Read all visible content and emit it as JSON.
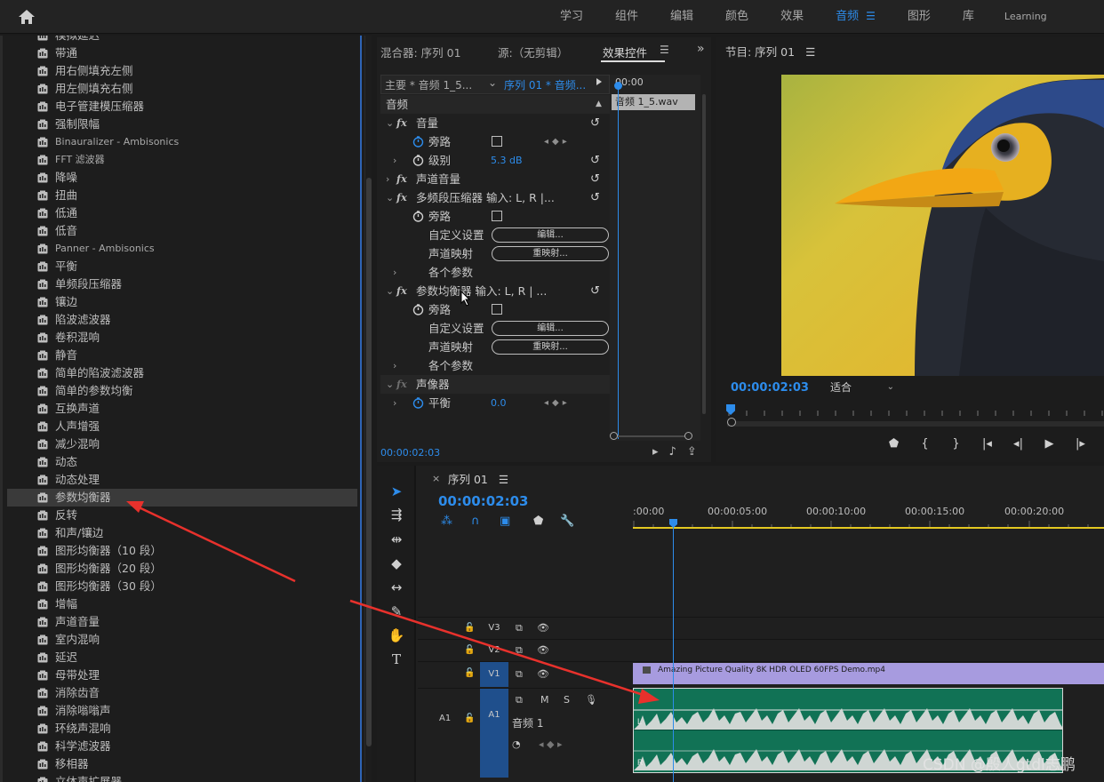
{
  "topbar": {
    "tabs": [
      {
        "label": "学习"
      },
      {
        "label": "组件"
      },
      {
        "label": "编辑"
      },
      {
        "label": "颜色"
      },
      {
        "label": "效果"
      },
      {
        "label": "音频"
      },
      {
        "label": "图形"
      },
      {
        "label": "库"
      },
      {
        "label": "Learning"
      }
    ],
    "active_color": "#2d8ceb"
  },
  "effects_list": {
    "items": [
      "模拟延迟",
      "带通",
      "用右侧填充左侧",
      "用左侧填充右侧",
      "电子管建模压缩器",
      "强制限幅",
      "Binauralizer - Ambisonics",
      "FFT 滤波器",
      "降噪",
      "扭曲",
      "低通",
      "低音",
      "Panner - Ambisonics",
      "平衡",
      "单频段压缩器",
      "镶边",
      "陷波滤波器",
      "卷积混响",
      "静音",
      "简单的陷波滤波器",
      "简单的参数均衡",
      "互换声道",
      "人声增强",
      "减少混响",
      "动态",
      "动态处理",
      "参数均衡器",
      "反转",
      "和声/镶边",
      "图形均衡器（10 段）",
      "图形均衡器（20 段）",
      "图形均衡器（30 段）",
      "增幅",
      "声道音量",
      "室内混响",
      "延迟",
      "母带处理",
      "消除齿音",
      "消除嗡嗡声",
      "环绕声混响",
      "科学滤波器",
      "移相器",
      "立体声扩展器"
    ],
    "selected_index": 26
  },
  "effect_controls": {
    "tabs": {
      "mixer": "混合器: 序列 01",
      "source": "源:（无剪辑）",
      "effect_controls": "效果控件"
    },
    "master_clip": "主要 * 音频 1_5...",
    "sequence_clip": "序列 01 * 音频...",
    "section_audio": "音频",
    "timeline_time": "00:00",
    "clip_name": "音频 1_5.wav",
    "current_time": "00:00:02:03",
    "rows": {
      "volume": "音量",
      "bypass": "旁路",
      "level": "级别",
      "level_value": "5.3 dB",
      "channel_volume": "声道音量",
      "multiband": "多频段压缩器 输入: L, R |...",
      "bypass2": "旁路",
      "custom_setup": "自定义设置",
      "edit_btn": "编辑...",
      "channel_map": "声道映射",
      "remap_btn": "重映射...",
      "params": "各个参数",
      "param_eq": "参数均衡器 输入: L, R | ...",
      "bypass3": "旁路",
      "custom_setup2": "自定义设置",
      "edit_btn2": "编辑...",
      "channel_map2": "声道映射",
      "remap_btn2": "重映射...",
      "params2": "各个参数",
      "panner": "声像器",
      "balance": "平衡",
      "balance_value": "0.0"
    }
  },
  "program_monitor": {
    "title": "节目: 序列 01",
    "timecode": "00:00:02:03",
    "fit": "适合"
  },
  "timeline": {
    "sequence_title": "序列 01",
    "timecode": "00:00:02:03",
    "ruler": [
      ":00:00",
      "00:00:05:00",
      "00:00:10:00",
      "00:00:15:00",
      "00:00:20:00"
    ],
    "tracks": {
      "v3": "V3",
      "v2": "V2",
      "v1": "V1",
      "a1": "A1",
      "a1_src": "A1",
      "a1_name": "音频 1",
      "mute": "M",
      "solo": "S"
    },
    "video_clip": "Amazing Picture Quality 8K HDR OLED 60FPS Demo.mp4"
  },
  "watermark": "CSDN @殷人gtdl志鹏"
}
